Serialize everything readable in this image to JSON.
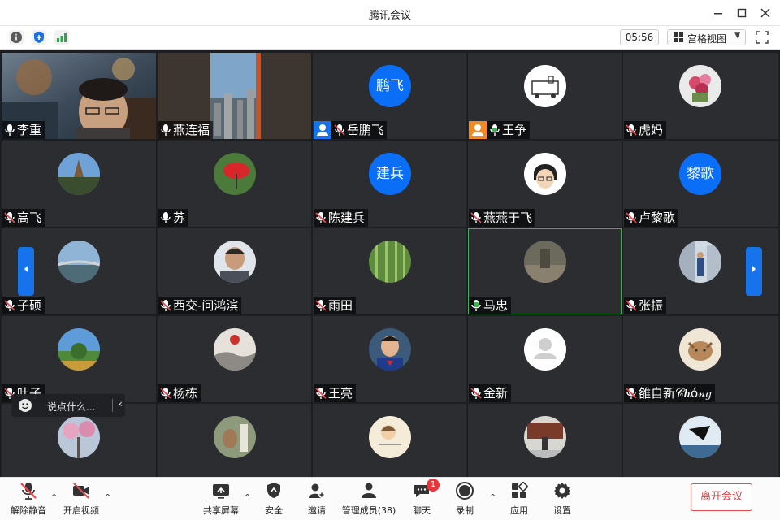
{
  "window": {
    "title": "腾讯会议"
  },
  "infobar": {
    "timer": "05:56",
    "view_mode": "宫格视图"
  },
  "participants": [
    {
      "name": "李重",
      "mic": "on"
    },
    {
      "name": "燕连福",
      "mic": "on"
    },
    {
      "name": "岳鹏飞",
      "mic": "muted",
      "avatar_text": "鹏飞",
      "role": "host-blue"
    },
    {
      "name": "王争",
      "mic": "active",
      "role": "host-orange"
    },
    {
      "name": "虎妈",
      "mic": "muted"
    },
    {
      "name": "高飞",
      "mic": "muted"
    },
    {
      "name": "苏",
      "mic": "on"
    },
    {
      "name": "陈建兵",
      "mic": "muted",
      "avatar_text": "建兵"
    },
    {
      "name": "燕燕于飞",
      "mic": "muted"
    },
    {
      "name": "卢黎歌",
      "mic": "muted",
      "avatar_text": "黎歌"
    },
    {
      "name": "子硕",
      "mic": "muted"
    },
    {
      "name": "西交-问鸿滨",
      "mic": "muted"
    },
    {
      "name": "雨田",
      "mic": "muted"
    },
    {
      "name": "马忠",
      "mic": "active"
    },
    {
      "name": "张振",
      "mic": "muted"
    },
    {
      "name": "叶子",
      "mic": "muted"
    },
    {
      "name": "杨栋",
      "mic": "muted"
    },
    {
      "name": "王亮",
      "mic": "muted"
    },
    {
      "name": "金新",
      "mic": "muted"
    },
    {
      "name": "雒自新𝒞𝒉ó𝓃𝑔",
      "mic": "muted"
    }
  ],
  "chat_hint": {
    "placeholder": "说点什么..."
  },
  "toolbar": {
    "unmute": "解除静音",
    "start_video": "开启视频",
    "share_screen": "共享屏幕",
    "security": "安全",
    "invite": "邀请",
    "members": "管理成员(38)",
    "chat": "聊天",
    "chat_badge": "1",
    "record": "录制",
    "apps": "应用",
    "settings": "设置",
    "leave": "离开会议"
  },
  "colors": {
    "accent": "#0b6ef6",
    "active_speaker": "#38b552",
    "danger": "#e5484d"
  }
}
